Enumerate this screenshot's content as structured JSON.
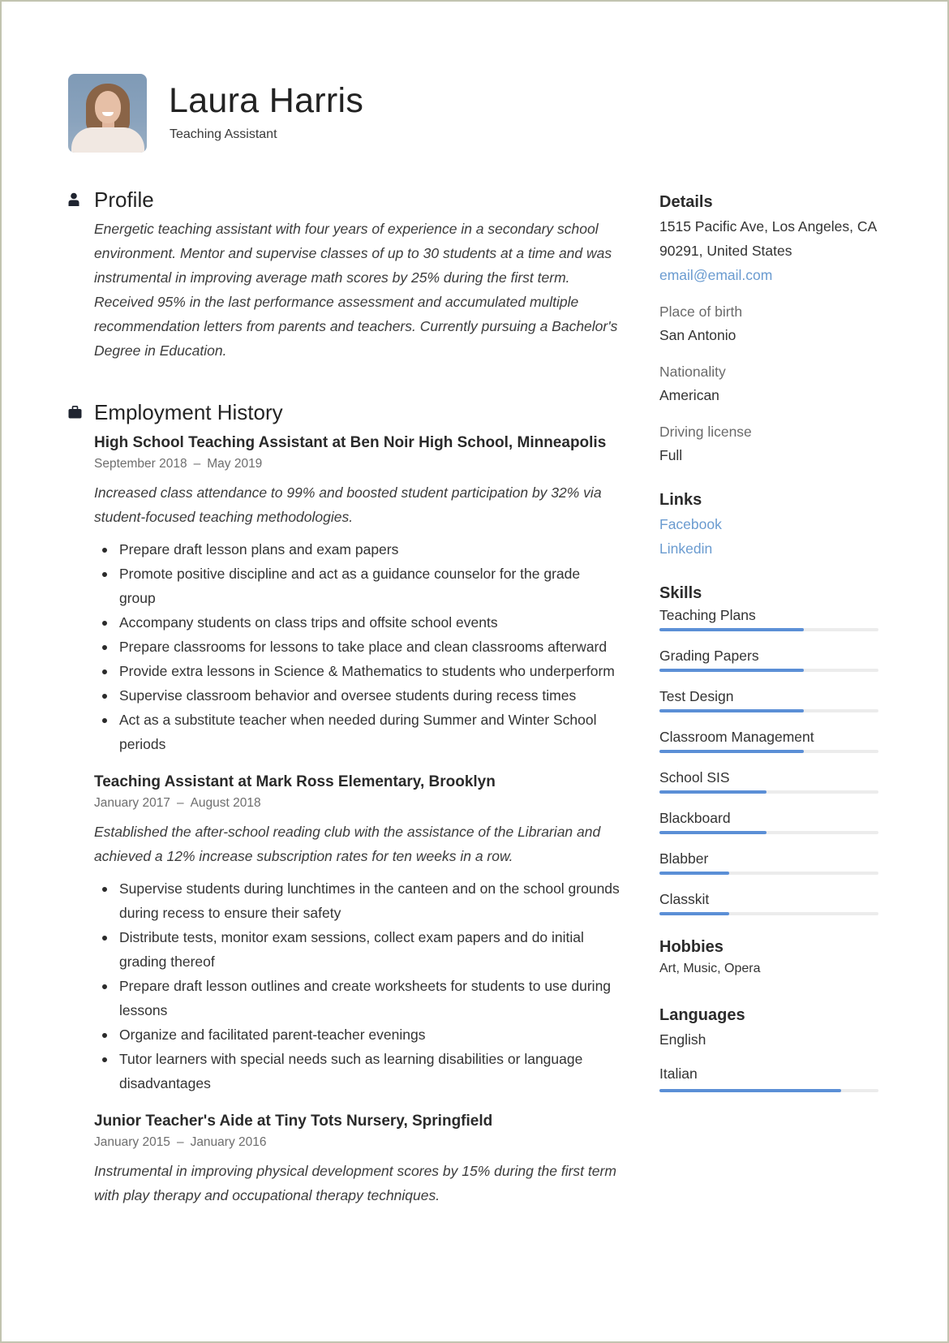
{
  "header": {
    "name": "Laura Harris",
    "title": "Teaching Assistant",
    "photo_alt": "portrait-photo"
  },
  "profile": {
    "heading": "Profile",
    "icon": "person-icon",
    "text": "Energetic teaching assistant with four years of experience in a secondary school environment. Mentor and supervise classes of up to 30 students at a time and was instrumental in improving average math scores by 25% during the first term. Received 95% in the last performance assessment and accumulated multiple recommendation letters from parents and teachers. Currently pursuing a Bachelor's Degree in Education."
  },
  "employment": {
    "heading": "Employment History",
    "icon": "briefcase-icon",
    "jobs": [
      {
        "title": "High School Teaching Assistant at Ben Noir High School, Minneapolis",
        "start": "September 2018",
        "end": "May 2019",
        "summary": "Increased class attendance to 99% and boosted student participation by 32% via student-focused teaching methodologies.",
        "bullets": [
          "Prepare draft lesson plans and exam papers",
          "Promote positive discipline and act as a guidance counselor for the grade group",
          "Accompany students on class trips and offsite school events",
          "Prepare classrooms for lessons to take place and clean classrooms afterward",
          "Provide extra lessons in Science & Mathematics to students who underperform",
          "Supervise classroom behavior and oversee students during recess times",
          "Act as a substitute teacher when needed during Summer and Winter School periods"
        ]
      },
      {
        "title": "Teaching Assistant at Mark Ross Elementary, Brooklyn",
        "start": "January 2017",
        "end": "August 2018",
        "summary": "Established the after-school reading club with the assistance of the Librarian and achieved a 12% increase subscription rates for ten weeks in a row.",
        "bullets": [
          "Supervise students during lunchtimes in the canteen and on the school grounds during recess to ensure their safety",
          "Distribute tests, monitor exam sessions, collect exam papers and do initial grading thereof",
          "Prepare draft lesson outlines and create worksheets for students to use during lessons",
          "Organize and facilitated parent-teacher evenings",
          "Tutor learners with special needs such as learning disabilities or language disadvantages"
        ]
      },
      {
        "title": "Junior Teacher's Aide at Tiny Tots Nursery, Springfield",
        "start": "January 2015",
        "end": "January 2016",
        "summary": "Instrumental in improving physical development scores by 15% during the first term with play therapy and occupational therapy techniques.",
        "bullets": []
      }
    ],
    "date_separator": "–"
  },
  "details": {
    "heading": "Details",
    "address_line1": "1515 Pacific Ave, Los Angeles, CA",
    "address_line2": "90291, United States",
    "email": "email@email.com",
    "place_of_birth_label": "Place of birth",
    "place_of_birth": "San Antonio",
    "nationality_label": "Nationality",
    "nationality": "American",
    "driving_license_label": "Driving license",
    "driving_license": "Full"
  },
  "links": {
    "heading": "Links",
    "items": [
      "Facebook",
      "Linkedin"
    ]
  },
  "skills": {
    "heading": "Skills",
    "items": [
      {
        "name": "Teaching Plans",
        "level": 0.66
      },
      {
        "name": "Grading Papers",
        "level": 0.66
      },
      {
        "name": "Test Design",
        "level": 0.66
      },
      {
        "name": "Classroom Management",
        "level": 0.66
      },
      {
        "name": "School SIS",
        "level": 0.49
      },
      {
        "name": "Blackboard",
        "level": 0.49
      },
      {
        "name": "Blabber",
        "level": 0.32
      },
      {
        "name": "Classkit",
        "level": 0.32
      }
    ]
  },
  "hobbies": {
    "heading": "Hobbies",
    "text": "Art, Music, Opera"
  },
  "languages": {
    "heading": "Languages",
    "items": [
      {
        "name": "English",
        "level": null
      },
      {
        "name": "Italian",
        "level": 0.83
      }
    ]
  },
  "colors": {
    "accent": "#5b8fd6",
    "link": "#6a9bd0",
    "bar_track": "#ececec",
    "page_border": "#c2c4b0"
  }
}
